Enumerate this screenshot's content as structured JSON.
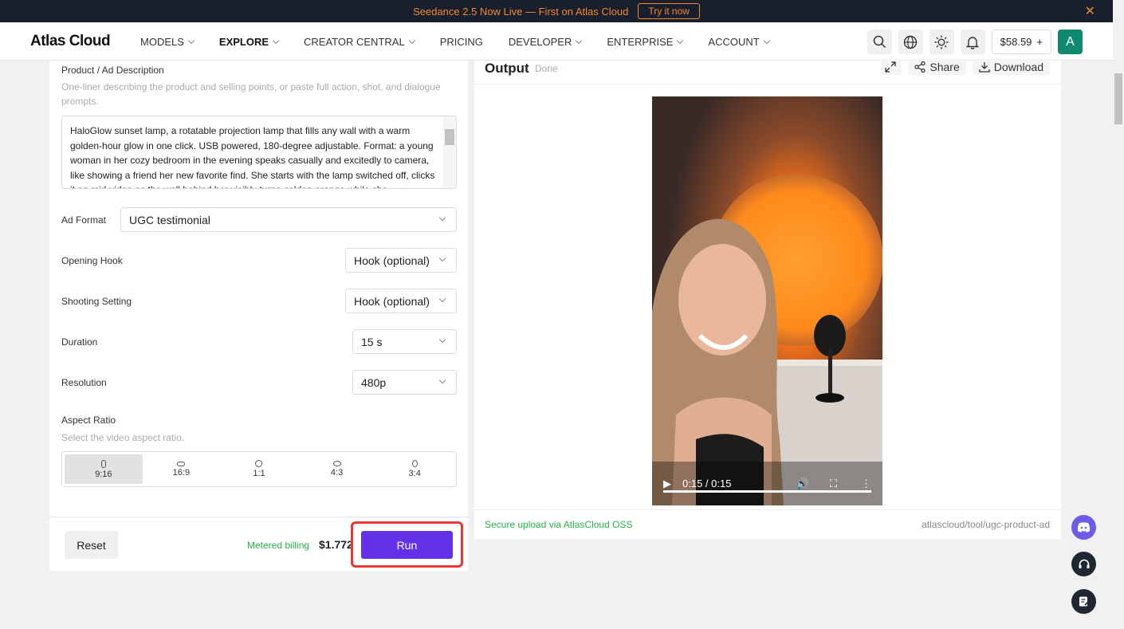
{
  "banner": {
    "text": "Seedance 2.5 Now Live — First on Atlas Cloud",
    "cta": "Try it now",
    "close": "✕"
  },
  "nav": {
    "logo": "Atlas Cloud",
    "items": [
      "MODELS",
      "EXPLORE",
      "CREATOR CENTRAL",
      "PRICING",
      "DEVELOPER",
      "ENTERPRISE",
      "ACCOUNT"
    ],
    "balance": "$58.59",
    "balance_add": "+",
    "avatar": "A"
  },
  "form": {
    "description_label": "Product / Ad Description",
    "description_hint": "One-liner describing the product and selling points, or paste full action, shot, and dialogue prompts.",
    "description_value": "HaloGlow sunset lamp, a rotatable projection lamp that fills any wall with a warm golden-hour glow in one click. USB powered, 180-degree adjustable. Format: a young woman in her cozy bedroom in the evening speaks casually and excitedly to camera, like showing a friend her new favorite find. She starts with the lamp switched off, clicks it on mid-video as the wall behind her visibly turns golden-orange while she",
    "ad_format_label": "Ad Format",
    "ad_format_value": "UGC testimonial",
    "opening_hook_label": "Opening Hook",
    "opening_hook_value": "Hook (optional)",
    "shooting_setting_label": "Shooting Setting",
    "shooting_setting_value": "Hook (optional)",
    "duration_label": "Duration",
    "duration_value": "15 s",
    "resolution_label": "Resolution",
    "resolution_value": "480p",
    "aspect_label": "Aspect Ratio",
    "aspect_hint": "Select the video aspect ratio.",
    "aspect_options": [
      "9:16",
      "16:9",
      "1:1",
      "4:3",
      "3:4"
    ],
    "aspect_selected": "9:16"
  },
  "footer": {
    "reset": "Reset",
    "billing": "Metered billing",
    "price": "$1.772",
    "run": "Run"
  },
  "output": {
    "title": "Output",
    "status": "Done",
    "share": "Share",
    "download": "Download",
    "time": "0:15 / 0:15",
    "progress": 1.0,
    "secure": "Secure upload via AtlasCloud OSS",
    "path": "atlascloud/tool/ugc-product-ad"
  },
  "colors": {
    "accent": "#6531e8",
    "highlight": "#e53935",
    "success": "#27b24a",
    "banner_text": "#f0892d"
  }
}
